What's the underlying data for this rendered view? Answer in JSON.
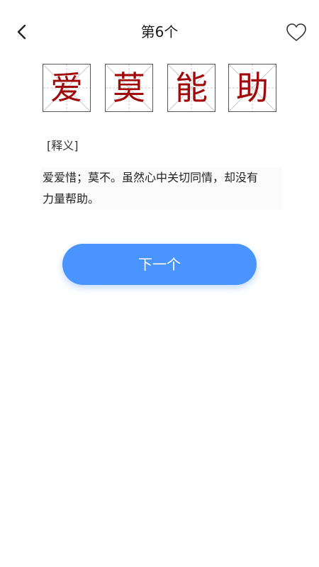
{
  "header": {
    "title": "第6个",
    "back_icon": "chevron-left-icon",
    "favorite_icon": "heart-outline-icon"
  },
  "idiom": {
    "chars": [
      "爱",
      "莫",
      "能",
      "助"
    ],
    "char_color": "#a00a0a"
  },
  "definition": {
    "label": "[释义]",
    "text_line1": "爱爱惜；莫不。虽然心中关切同情，却没有",
    "text_line2": "力量帮助。"
  },
  "actions": {
    "next_label": "下一个",
    "accent_color": "#4a94ff"
  }
}
